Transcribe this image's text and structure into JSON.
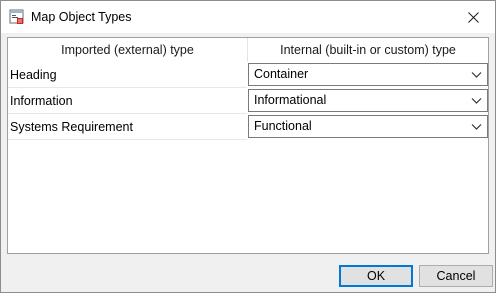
{
  "window": {
    "title": "Map Object Types",
    "close_icon": "close-icon",
    "app_icon": "app-icon"
  },
  "table": {
    "headers": [
      "Imported (external) type",
      "Internal (built-in or custom) type"
    ],
    "rows": [
      {
        "external": "Heading",
        "internal": "Container"
      },
      {
        "external": "Information",
        "internal": "Informational"
      },
      {
        "external": "Systems Requirement",
        "internal": "Functional"
      }
    ]
  },
  "buttons": {
    "ok": "OK",
    "cancel": "Cancel"
  },
  "colors": {
    "accent": "#0078d7",
    "dialog_bg": "#f0f0f0"
  }
}
